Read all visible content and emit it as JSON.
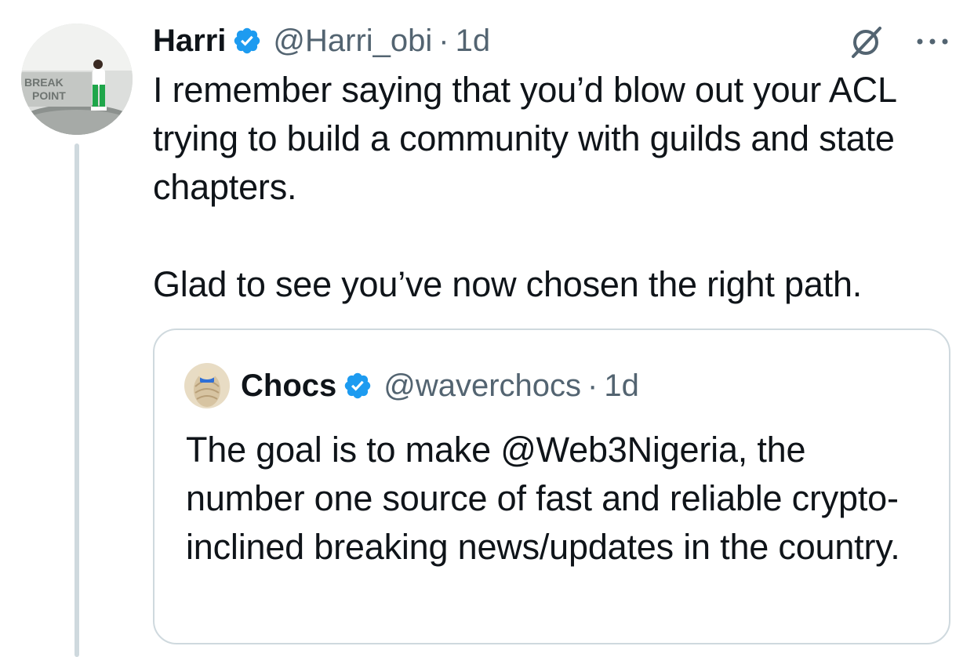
{
  "tweet": {
    "author_name": "Harri",
    "author_handle": "@Harri_obi",
    "separator": "·",
    "time": "1d",
    "text_line1": "I remember saying that you’d blow out your ACL trying to build a community with guilds and state chapters.",
    "text_line2": "Glad to see you’ve now chosen the right path.",
    "avatar_text": "BREAK POINT"
  },
  "quote": {
    "author_name": "Chocs",
    "author_handle": "@waverchocs",
    "separator": "·",
    "time": "1d",
    "text": "The goal is to make @Web3Nigeria, the number one source of fast and reliable crypto-inclined breaking news/updates in the country."
  },
  "icons": {
    "verified": "verified-badge-icon",
    "grok": "grok-icon",
    "more": "more-icon"
  },
  "colors": {
    "verified_blue": "#1d9bf0",
    "secondary_text": "#536471",
    "primary_text": "#0f1419",
    "border": "#cfd9de"
  }
}
